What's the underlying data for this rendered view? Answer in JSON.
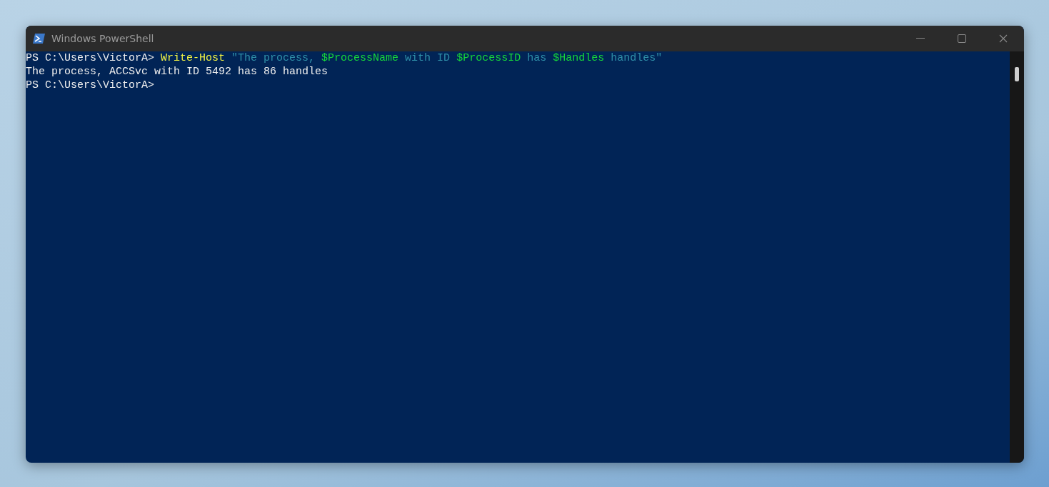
{
  "window": {
    "title": "Windows PowerShell"
  },
  "console": {
    "lines": [
      {
        "tokens": [
          {
            "kind": "prompt",
            "text": "PS C:\\Users\\VictorA> "
          },
          {
            "kind": "command",
            "text": "Write-Host"
          },
          {
            "kind": "string",
            "text": " \"The process, "
          },
          {
            "kind": "variable",
            "text": "$ProcessName"
          },
          {
            "kind": "string",
            "text": " with ID "
          },
          {
            "kind": "variable",
            "text": "$ProcessID"
          },
          {
            "kind": "string",
            "text": " has "
          },
          {
            "kind": "variable",
            "text": "$Handles"
          },
          {
            "kind": "string",
            "text": " handles\""
          }
        ]
      },
      {
        "tokens": [
          {
            "kind": "output",
            "text": "The process, ACCSvc with ID 5492 has 86 handles"
          }
        ]
      },
      {
        "tokens": [
          {
            "kind": "prompt",
            "text": "PS C:\\Users\\VictorA>"
          }
        ]
      }
    ]
  }
}
